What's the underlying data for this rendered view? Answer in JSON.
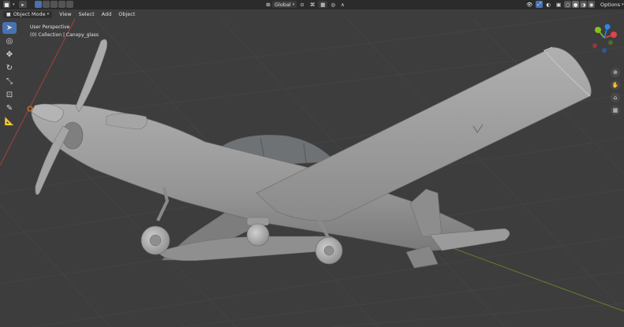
{
  "header": {
    "mode_label": "Object Mode",
    "menus": [
      "View",
      "Select",
      "Add",
      "Object"
    ],
    "transform_orientation": "Global",
    "options_label": "Options"
  },
  "viewport": {
    "view_name": "User Perspective",
    "collection_info": "(0) Collection | Canopy_glass",
    "object_name": "Canopy_glass"
  },
  "tools": [
    {
      "name": "select-box",
      "active": true
    },
    {
      "name": "cursor",
      "active": false
    },
    {
      "name": "move",
      "active": false
    },
    {
      "name": "rotate",
      "active": false
    },
    {
      "name": "scale",
      "active": false
    },
    {
      "name": "transform",
      "active": false
    },
    {
      "name": "annotate",
      "active": false
    },
    {
      "name": "measure",
      "active": false
    }
  ],
  "gizmo": {
    "axes": [
      "X",
      "Y",
      "Z"
    ],
    "colors": {
      "x": "#e0424c",
      "y": "#82c21a",
      "z": "#2f85e8"
    }
  },
  "colors": {
    "accent": "#4772b3",
    "viewport_bg": "#3d3d3d",
    "header_bg": "#2b2b2b",
    "model_gray": "#9a9a9a"
  }
}
